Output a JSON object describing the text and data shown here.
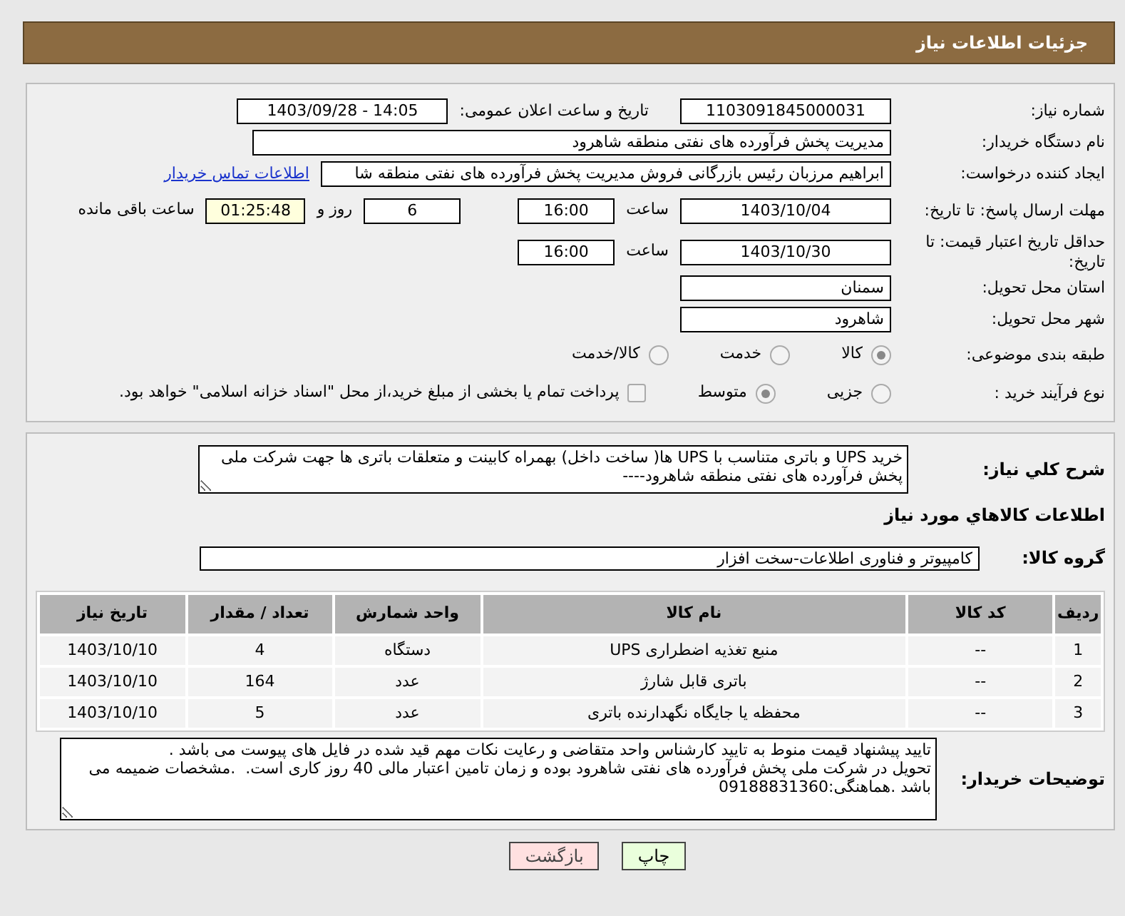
{
  "title": "جزئیات اطلاعات نیاز",
  "need_number": {
    "label": "شماره نیاز:",
    "value": "1103091845000031"
  },
  "announce": {
    "label": "تاریخ و ساعت اعلان عمومی:",
    "value": "1403/09/28 - 14:05"
  },
  "buyer_org": {
    "label": "نام دستگاه خریدار:",
    "value": "مدیریت پخش فرآورده های نفتی منطقه شاهرود"
  },
  "requester": {
    "label": "ایجاد کننده درخواست:",
    "value": "ابراهیم مرزبان رئیس بازرگانی فروش مدیریت پخش فرآورده های نفتی منطقه شا",
    "link": "اطلاعات تماس خریدار"
  },
  "deadline": {
    "label": "مهلت ارسال پاسخ: تا تاریخ:",
    "date": "1403/10/04",
    "time_label": "ساعت",
    "time": "16:00",
    "days": "6",
    "days_label": "روز و",
    "remaining": "01:25:48",
    "remaining_label": "ساعت باقی مانده"
  },
  "validity": {
    "label": "حداقل تاریخ اعتبار قیمت: تا تاریخ:",
    "date": "1403/10/30",
    "time_label": "ساعت",
    "time": "16:00"
  },
  "province": {
    "label": "استان محل تحویل:",
    "value": "سمنان"
  },
  "city": {
    "label": "شهر محل تحویل:",
    "value": "شاهرود"
  },
  "category": {
    "label": "طبقه بندی موضوعی:",
    "options": [
      {
        "label": "کالا",
        "selected": true
      },
      {
        "label": "خدمت",
        "selected": false
      },
      {
        "label": "کالا/خدمت",
        "selected": false
      }
    ]
  },
  "process": {
    "label": "نوع فرآیند خرید :",
    "options": [
      {
        "label": "جزیی",
        "selected": false
      },
      {
        "label": "متوسط",
        "selected": true
      }
    ],
    "treasury": {
      "checked": false,
      "text": "پرداخت تمام یا بخشی از مبلغ خرید،از محل \"اسناد خزانه اسلامی\" خواهد بود."
    }
  },
  "description": {
    "label": "شرح کلي نياز:",
    "value": "خرید UPS و باتری متناسب با UPS ها( ساخت داخل) بهمراه کابینت و متعلقات باتری ها جهت شرکت ملی پخش فرآورده های نفتی منطقه شاهرود----"
  },
  "goods_heading": "اطلاعات کالاهاي مورد نياز",
  "goods_group": {
    "label": "گروه کالا:",
    "value": "کامپیوتر و فناوری اطلاعات-سخت افزار"
  },
  "table": {
    "columns": [
      "ردیف",
      "کد کالا",
      "نام کالا",
      "واحد شمارش",
      "تعداد / مقدار",
      "تاریخ نیاز"
    ],
    "rows": [
      [
        "1",
        "--",
        "منبع تغذیه اضطراری UPS",
        "دستگاه",
        "4",
        "1403/10/10"
      ],
      [
        "2",
        "--",
        "باتری قابل شارژ",
        "عدد",
        "164",
        "1403/10/10"
      ],
      [
        "3",
        "--",
        "محفظه یا جایگاه نگهدارنده باتری",
        "عدد",
        "5",
        "1403/10/10"
      ]
    ]
  },
  "notes": {
    "label": "توضیحات خریدار:",
    "value": "تایید پیشنهاد قیمت منوط به تایید کارشناس واحد متقاضی و رعایت نکات مهم قید شده در فایل های پیوست می باشد .\nتحویل در شرکت ملی پخش فرآورده های نفتی شاهرود بوده و زمان تامین اعتبار مالی 40 روز کاری است.  .مشخصات ضمیمه می باشد .هماهنگی:09188831360"
  },
  "buttons": [
    {
      "label": "چاپ",
      "kind": "print"
    },
    {
      "label": "بازگشت",
      "kind": "back"
    }
  ]
}
